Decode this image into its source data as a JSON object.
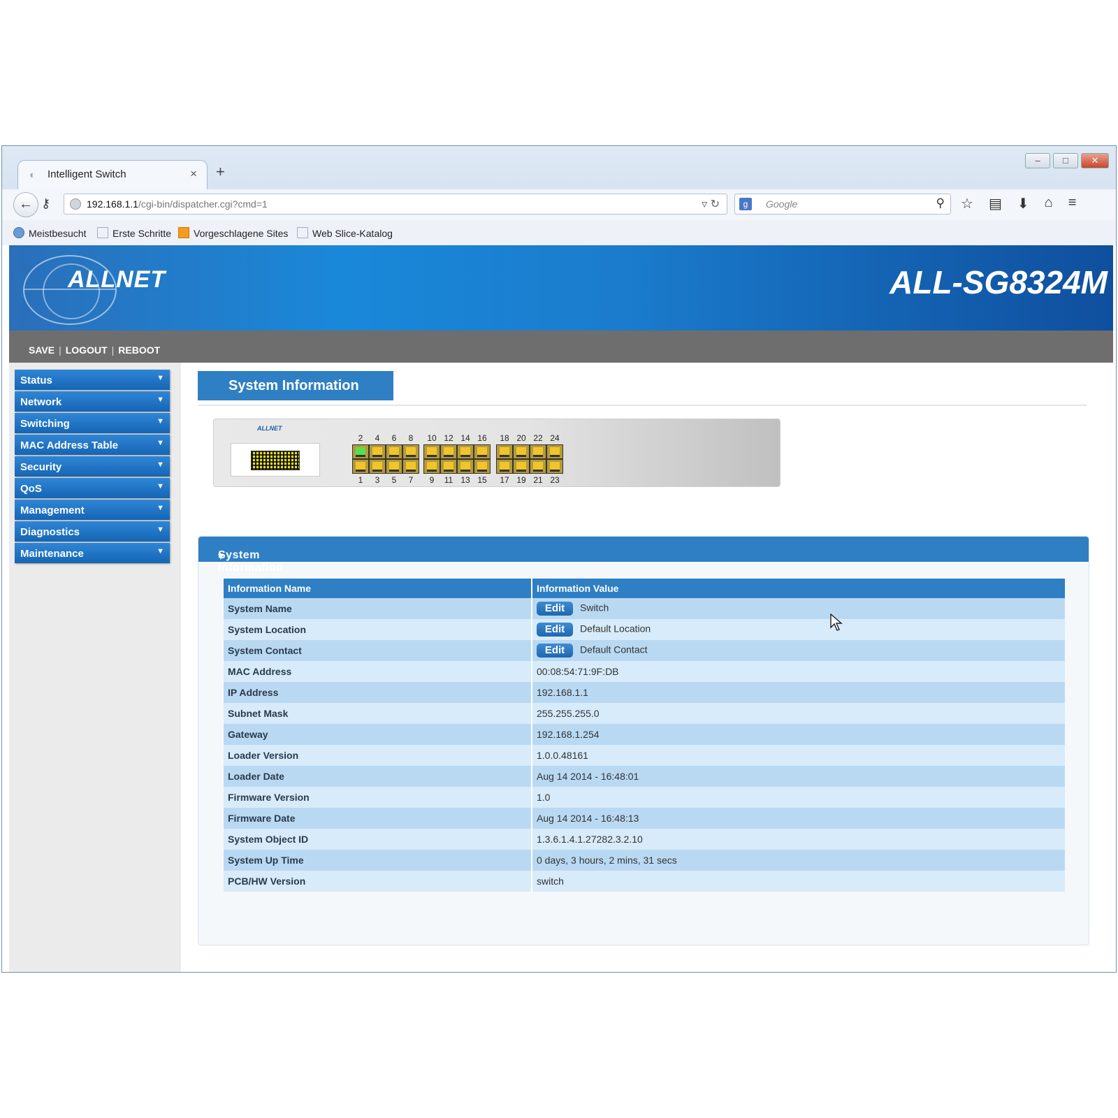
{
  "browser": {
    "tab_title": "Intelligent Switch",
    "tab_close": "×",
    "new_tab": "+",
    "url_host": "192.168.1.1",
    "url_path": "/cgi-bin/dispatcher.cgi?cmd=1",
    "search_placeholder": "Google",
    "bookmarks": [
      "Meistbesucht",
      "Erste Schritte",
      "Vorgeschlagene Sites",
      "Web Slice-Katalog"
    ]
  },
  "header": {
    "logo": "ALLNET",
    "model": "ALL-SG8324M"
  },
  "actions": [
    "SAVE",
    "LOGOUT",
    "REBOOT"
  ],
  "sidebar": {
    "items": [
      "Status",
      "Network",
      "Switching",
      "MAC Address Table",
      "Security",
      "QoS",
      "Management",
      "Diagnostics",
      "Maintenance"
    ]
  },
  "page": {
    "title": "System Information",
    "section_title": "System Information"
  },
  "switch_panel": {
    "logo": "ALLNET",
    "top_ports": [
      "2",
      "4",
      "6",
      "8",
      "10",
      "12",
      "14",
      "16",
      "18",
      "20",
      "22",
      "24"
    ],
    "bottom_ports": [
      "1",
      "3",
      "5",
      "7",
      "9",
      "11",
      "13",
      "15",
      "17",
      "19",
      "21",
      "23"
    ],
    "linked_ports": [
      "2"
    ]
  },
  "table": {
    "headers": [
      "Information Name",
      "Information Value"
    ],
    "edit_label": "Edit",
    "rows": [
      {
        "name": "System Name",
        "value": "Switch",
        "editable": true
      },
      {
        "name": "System Location",
        "value": "Default Location",
        "editable": true
      },
      {
        "name": "System Contact",
        "value": "Default Contact",
        "editable": true
      },
      {
        "name": "MAC Address",
        "value": "00:08:54:71:9F:DB",
        "editable": false
      },
      {
        "name": "IP Address",
        "value": "192.168.1.1",
        "editable": false
      },
      {
        "name": "Subnet Mask",
        "value": "255.255.255.0",
        "editable": false
      },
      {
        "name": "Gateway",
        "value": "192.168.1.254",
        "editable": false
      },
      {
        "name": "Loader Version",
        "value": "1.0.0.48161",
        "editable": false
      },
      {
        "name": "Loader Date",
        "value": "Aug 14 2014 - 16:48:01",
        "editable": false
      },
      {
        "name": "Firmware Version",
        "value": "1.0",
        "editable": false
      },
      {
        "name": "Firmware Date",
        "value": "Aug 14 2014 - 16:48:13",
        "editable": false
      },
      {
        "name": "System Object ID",
        "value": "1.3.6.1.4.1.27282.3.2.10",
        "editable": false
      },
      {
        "name": "System Up Time",
        "value": "0 days, 3 hours, 2 mins, 31 secs",
        "editable": false
      },
      {
        "name": "PCB/HW Version",
        "value": "switch",
        "editable": false
      }
    ]
  }
}
